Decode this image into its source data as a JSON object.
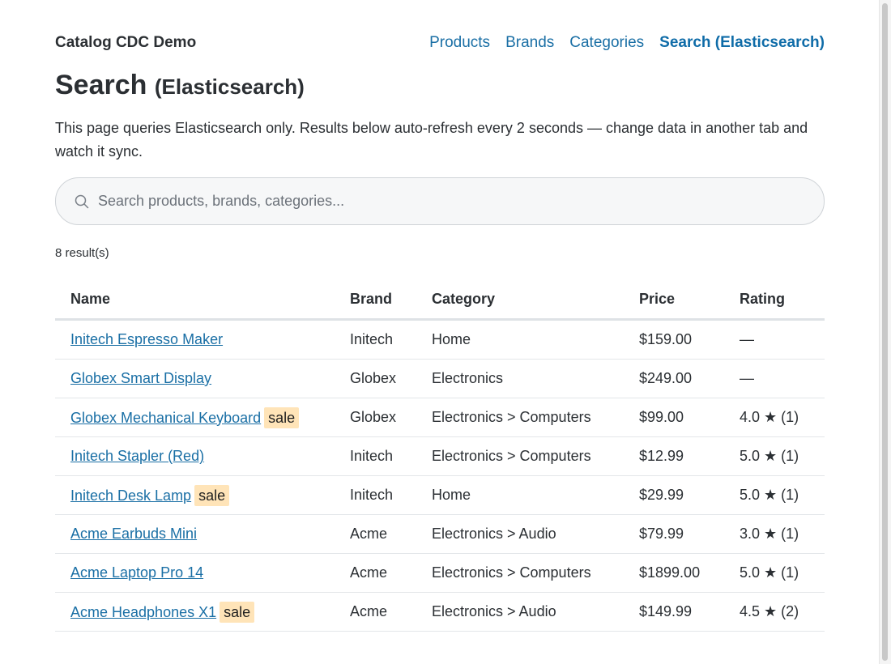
{
  "header": {
    "brand": "Catalog CDC Demo",
    "nav": [
      {
        "label": "Products",
        "active": false
      },
      {
        "label": "Brands",
        "active": false
      },
      {
        "label": "Categories",
        "active": false
      },
      {
        "label": "Search (Elasticsearch)",
        "active": true
      }
    ]
  },
  "page": {
    "title_main": "Search",
    "title_sub": "(Elasticsearch)",
    "description": "This page queries Elasticsearch only. Results below auto-refresh every 2 seconds — change data in another tab and watch it sync."
  },
  "search": {
    "placeholder": "Search products, brands, categories...",
    "value": "",
    "icon": "search-icon"
  },
  "results": {
    "count_label": "8 result(s)",
    "columns": [
      "Name",
      "Brand",
      "Category",
      "Price",
      "Rating"
    ],
    "badge_label": "sale",
    "rows": [
      {
        "name": "Initech Espresso Maker",
        "sale": false,
        "brand": "Initech",
        "category": "Home",
        "price": "$159.00",
        "rating": "—"
      },
      {
        "name": "Globex Smart Display",
        "sale": false,
        "brand": "Globex",
        "category": "Electronics",
        "price": "$249.00",
        "rating": "—"
      },
      {
        "name": "Globex Mechanical Keyboard",
        "sale": true,
        "brand": "Globex",
        "category": "Electronics > Computers",
        "price": "$99.00",
        "rating": "4.0 ★ (1)"
      },
      {
        "name": "Initech Stapler (Red)",
        "sale": false,
        "brand": "Initech",
        "category": "Electronics > Computers",
        "price": "$12.99",
        "rating": "5.0 ★ (1)"
      },
      {
        "name": "Initech Desk Lamp",
        "sale": true,
        "brand": "Initech",
        "category": "Home",
        "price": "$29.99",
        "rating": "5.0 ★ (1)"
      },
      {
        "name": "Acme Earbuds Mini",
        "sale": false,
        "brand": "Acme",
        "category": "Electronics > Audio",
        "price": "$79.99",
        "rating": "3.0 ★ (1)"
      },
      {
        "name": "Acme Laptop Pro 14",
        "sale": false,
        "brand": "Acme",
        "category": "Electronics > Computers",
        "price": "$1899.00",
        "rating": "5.0 ★ (1)"
      },
      {
        "name": "Acme Headphones X1",
        "sale": true,
        "brand": "Acme",
        "category": "Electronics > Audio",
        "price": "$149.99",
        "rating": "4.5 ★ (2)"
      }
    ]
  },
  "colors": {
    "link": "#1a6fa5",
    "text": "#2b2f33",
    "sale_badge": "#ffe4b8"
  }
}
